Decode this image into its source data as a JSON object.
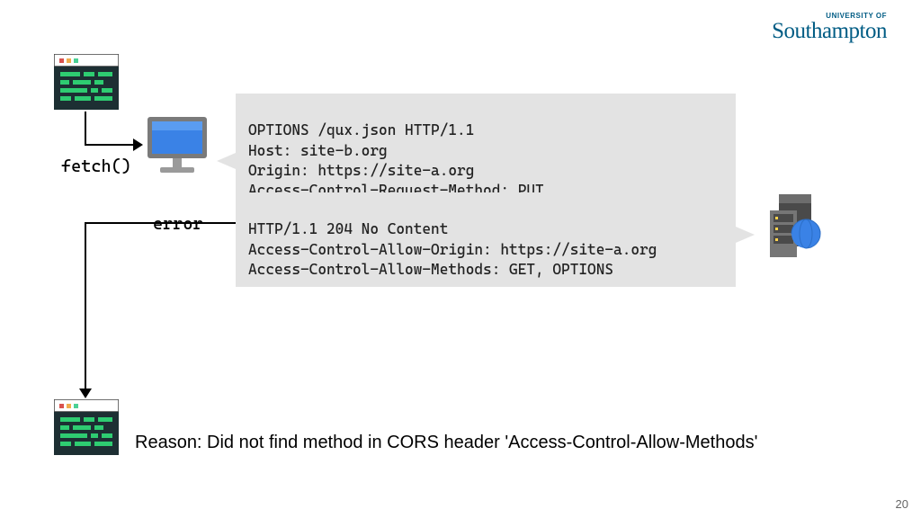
{
  "logo": {
    "university_of": "UNIVERSITY OF",
    "name": "Southampton"
  },
  "labels": {
    "fetch": "fetch()",
    "error": "error"
  },
  "request": {
    "line1": "OPTIONS /qux.json HTTP/1.1",
    "line2": "Host: site-b.org",
    "line3": "Origin: https://site-a.org",
    "line4": "Access-Control-Request-Method: PUT"
  },
  "response": {
    "line1": "HTTP/1.1 204 No Content",
    "line2": "Access-Control-Allow-Origin: https://site-a.org",
    "line3": "Access-Control-Allow-Methods: GET, OPTIONS"
  },
  "reason": "Reason: Did not find method in CORS header 'Access-Control-Allow-Methods'",
  "page_number": "20"
}
